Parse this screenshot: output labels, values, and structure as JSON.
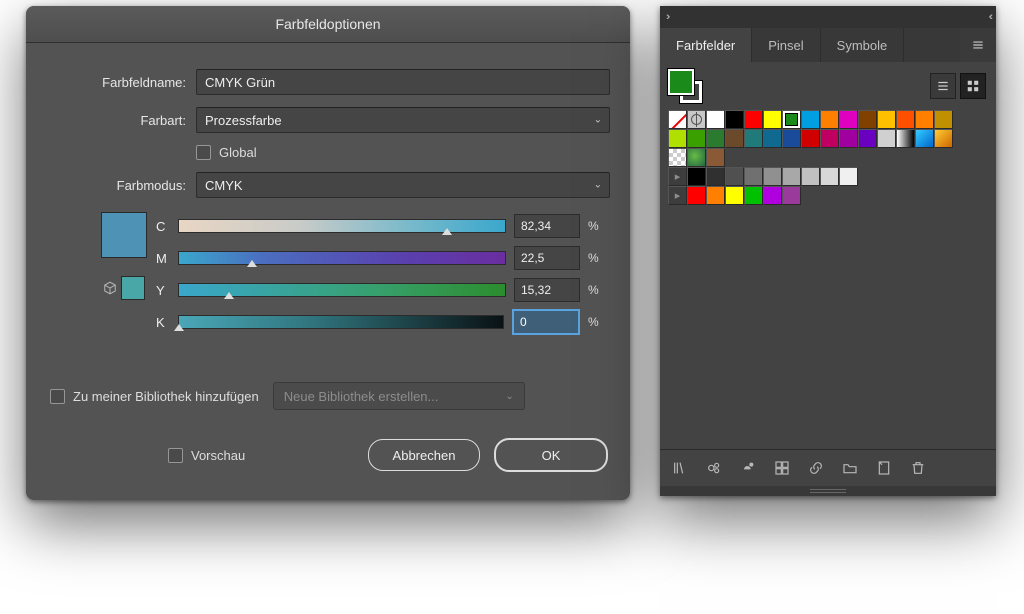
{
  "dialog": {
    "title": "Farbfeldoptionen",
    "name_label": "Farbfeldname:",
    "name_value": "CMYK Grün",
    "type_label": "Farbart:",
    "type_value": "Prozessfarbe",
    "global_label": "Global",
    "mode_label": "Farbmodus:",
    "mode_value": "CMYK",
    "channels": {
      "c": {
        "label": "C",
        "value": "82,34",
        "pct": 82.34
      },
      "m": {
        "label": "M",
        "value": "22,5",
        "pct": 22.5
      },
      "y": {
        "label": "Y",
        "value": "15,32",
        "pct": 15.32
      },
      "k": {
        "label": "K",
        "value": "0",
        "pct": 0
      }
    },
    "percent": "%",
    "preview_color": "#4e93b6",
    "proxy_color": "#4aa7a7",
    "library_checkbox": "Zu meiner Bibliothek hinzufügen",
    "library_select": "Neue Bibliothek erstellen...",
    "preview_checkbox": "Vorschau",
    "cancel": "Abbrechen",
    "ok": "OK"
  },
  "panel": {
    "tabs": [
      "Farbfelder",
      "Pinsel",
      "Symbole"
    ],
    "active_tab": 0,
    "fill_color": "#1a8a1a",
    "rows": [
      [
        "none",
        "reg",
        "#ffffff",
        "#000000",
        "#ff0000",
        "#ffff00",
        "#1a8a1a:sel",
        "#00a0e0",
        "#ff7f00",
        "#e000c0",
        "#804000",
        "#ffc000",
        "#ff5000",
        "#ff8000",
        "#c09000"
      ],
      [
        "#b0e000",
        "#3aa000",
        "#2a7a30",
        "#6a4a2a",
        "#207a7a",
        "#106a90",
        "#1a4a9a",
        "#d00000",
        "#c00060",
        "#a000a0",
        "#6a00c0",
        "#d0d0d0",
        "grad1",
        "grad2",
        "grad3"
      ],
      [
        "pat1",
        "pat2",
        "pat3"
      ],
      [
        "folder",
        "#000000",
        "#303030",
        "#505050",
        "#707070",
        "#909090",
        "#a8a8a8",
        "#c0c0c0",
        "#d8d8d8",
        "#f0f0f0"
      ],
      [
        "folder",
        "#ff0000",
        "#ff8000",
        "#ffff00",
        "#00c000",
        "#b000e0",
        "#9a3a9a"
      ]
    ]
  }
}
